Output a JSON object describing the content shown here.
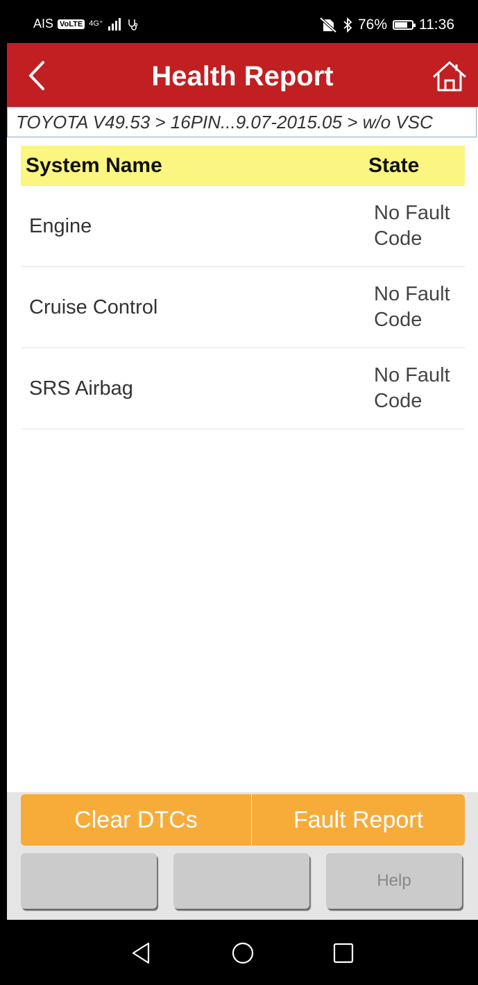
{
  "status_bar": {
    "carrier": "AIS",
    "volte": "VoLTE",
    "network": "4G⁺",
    "battery_percent": "76%",
    "battery_level": 0.76,
    "time": "11:36"
  },
  "header": {
    "title": "Health Report",
    "back_icon": "chevron-left-icon",
    "home_icon": "home-icon"
  },
  "breadcrumb": "TOYOTA V49.53 > 16PIN...9.07-2015.05 > w/o VSC",
  "table": {
    "headers": {
      "system_name": "System Name",
      "state": "State"
    },
    "rows": [
      {
        "name": "Engine",
        "state": "No Fault Code"
      },
      {
        "name": "Cruise Control",
        "state": "No Fault Code"
      },
      {
        "name": "SRS Airbag",
        "state": "No Fault Code"
      }
    ]
  },
  "actions": {
    "clear_dtcs": "Clear DTCs",
    "fault_report": "Fault Report",
    "button_1": "",
    "button_2": "",
    "help": "Help"
  },
  "colors": {
    "header_bg": "#c21f22",
    "table_header_bg": "#fbf582",
    "action_orange": "#f7ac3a",
    "gray_button": "#cbcbcb"
  }
}
